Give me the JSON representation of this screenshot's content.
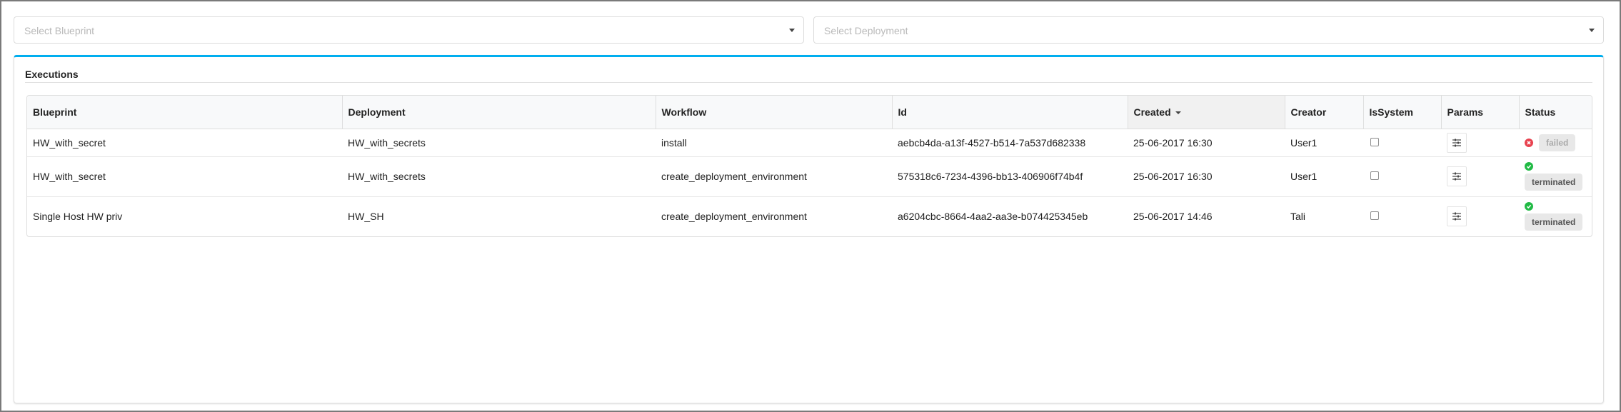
{
  "filters": {
    "blueprint_placeholder": "Select Blueprint",
    "deployment_placeholder": "Select Deployment"
  },
  "widget": {
    "title": "Executions",
    "accent_color": "#00aeef"
  },
  "table": {
    "columns": [
      "Blueprint",
      "Deployment",
      "Workflow",
      "Id",
      "Created",
      "Creator",
      "IsSystem",
      "Params",
      "Status"
    ],
    "sorted_column": "Created",
    "sort_direction": "descending",
    "rows": [
      {
        "blueprint": "HW_with_secret",
        "deployment": "HW_with_secrets",
        "workflow": "install",
        "id": "aebcb4da-a13f-4527-b514-7a537d682338",
        "created": "25-06-2017 16:30",
        "creator": "User1",
        "is_system": false,
        "params_icon": "sliders-icon",
        "status": "failed",
        "status_icon": "x-circle-icon",
        "status_color": "#e8424f"
      },
      {
        "blueprint": "HW_with_secret",
        "deployment": "HW_with_secrets",
        "workflow": "create_deployment_environment",
        "id": "575318c6-7234-4396-bb13-406906f74b4f",
        "created": "25-06-2017 16:30",
        "creator": "User1",
        "is_system": false,
        "params_icon": "sliders-icon",
        "status": "terminated",
        "status_icon": "check-circle-icon",
        "status_color": "#21ba45"
      },
      {
        "blueprint": "Single Host HW priv",
        "deployment": "HW_SH",
        "workflow": "create_deployment_environment",
        "id": "a6204cbc-8664-4aa2-aa3e-b074425345eb",
        "created": "25-06-2017 14:46",
        "creator": "Tali",
        "is_system": false,
        "params_icon": "sliders-icon",
        "status": "terminated",
        "status_icon": "check-circle-icon",
        "status_color": "#21ba45"
      }
    ]
  }
}
